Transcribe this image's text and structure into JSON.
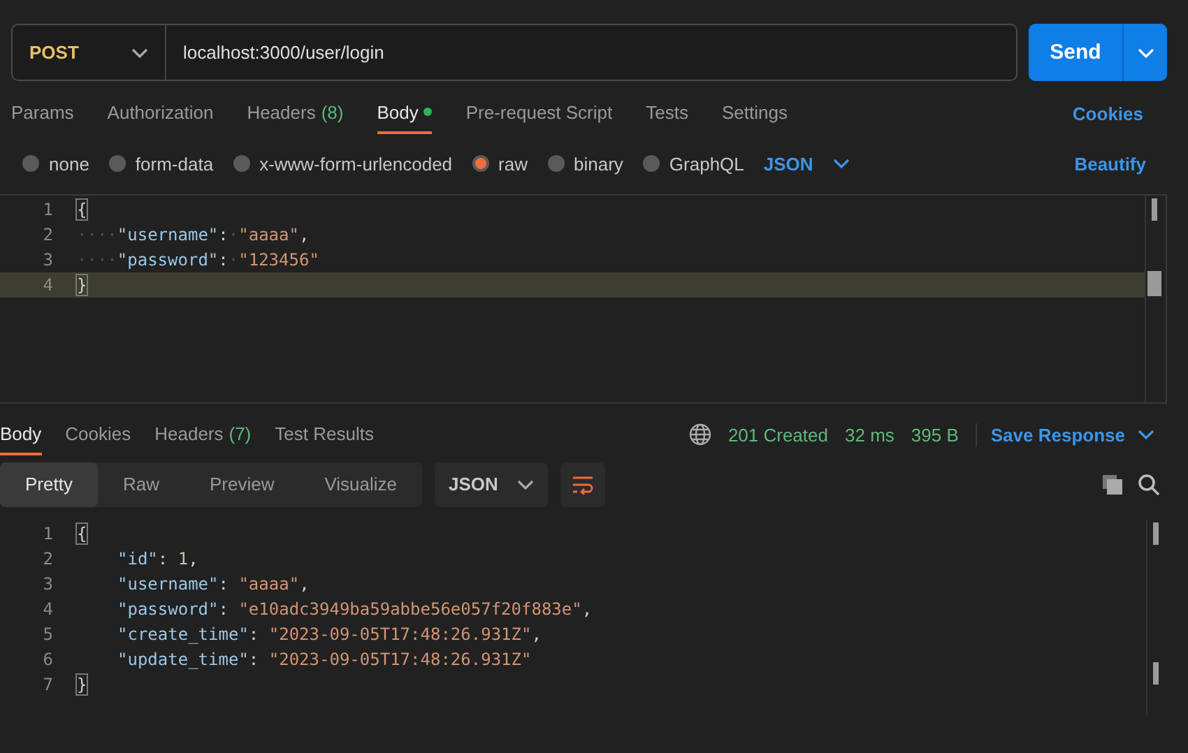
{
  "request": {
    "method": "POST",
    "url": "localhost:3000/user/login",
    "send_label": "Send"
  },
  "request_tabs": [
    {
      "label": "Params",
      "dot": false,
      "selected": false
    },
    {
      "label": "Authorization",
      "dot": false,
      "selected": false
    },
    {
      "label": "Headers",
      "count": "(8)",
      "dot": false,
      "selected": false
    },
    {
      "label": "Body",
      "dot": true,
      "selected": true
    },
    {
      "label": "Pre-request Script",
      "dot": false,
      "selected": false
    },
    {
      "label": "Tests",
      "dot": false,
      "selected": false
    },
    {
      "label": "Settings",
      "dot": false,
      "selected": false
    }
  ],
  "cookies_link": "Cookies",
  "body_types": [
    {
      "label": "none",
      "selected": false
    },
    {
      "label": "form-data",
      "selected": false
    },
    {
      "label": "x-www-form-urlencoded",
      "selected": false
    },
    {
      "label": "raw",
      "selected": true
    },
    {
      "label": "binary",
      "selected": false
    },
    {
      "label": "GraphQL",
      "selected": false
    }
  ],
  "raw_format": "JSON",
  "beautify_link": "Beautify",
  "request_editor": [
    {
      "number": "1",
      "current": false,
      "tokens": [
        {
          "kind": "brace",
          "text": "{"
        }
      ]
    },
    {
      "number": "2",
      "current": false,
      "tokens": [
        {
          "kind": "ws",
          "text": "····"
        },
        {
          "kind": "key",
          "text": "\"username\""
        },
        {
          "kind": "punct",
          "text": ":"
        },
        {
          "kind": "ws",
          "text": "·"
        },
        {
          "kind": "string",
          "text": "\"aaaa\""
        },
        {
          "kind": "punct",
          "text": ","
        }
      ]
    },
    {
      "number": "3",
      "current": false,
      "tokens": [
        {
          "kind": "ws",
          "text": "····"
        },
        {
          "kind": "key",
          "text": "\"password\""
        },
        {
          "kind": "punct",
          "text": ":"
        },
        {
          "kind": "ws",
          "text": "·"
        },
        {
          "kind": "string",
          "text": "\"123456\""
        }
      ]
    },
    {
      "number": "4",
      "current": true,
      "tokens": [
        {
          "kind": "brace",
          "text": "}"
        }
      ]
    }
  ],
  "response_tabs": [
    {
      "label": "Body",
      "selected": true
    },
    {
      "label": "Cookies",
      "selected": false
    },
    {
      "label": "Headers",
      "count": "(7)",
      "selected": false
    },
    {
      "label": "Test Results",
      "selected": false
    }
  ],
  "response_status": {
    "status": "201 Created",
    "time": "32 ms",
    "size": "395 B",
    "save_label": "Save Response"
  },
  "view_modes": [
    {
      "label": "Pretty",
      "selected": true
    },
    {
      "label": "Raw",
      "selected": false
    },
    {
      "label": "Preview",
      "selected": false
    },
    {
      "label": "Visualize",
      "selected": false
    }
  ],
  "response_format": "JSON",
  "response_editor": [
    {
      "number": "1",
      "indented": false,
      "tokens": [
        {
          "kind": "brace",
          "text": "{"
        }
      ]
    },
    {
      "number": "2",
      "indented": true,
      "tokens": [
        {
          "kind": "key",
          "text": "\"id\""
        },
        {
          "kind": "punct",
          "text": ": "
        },
        {
          "kind": "number",
          "text": "1"
        },
        {
          "kind": "punct",
          "text": ","
        }
      ]
    },
    {
      "number": "3",
      "indented": true,
      "tokens": [
        {
          "kind": "key",
          "text": "\"username\""
        },
        {
          "kind": "punct",
          "text": ": "
        },
        {
          "kind": "string",
          "text": "\"aaaa\""
        },
        {
          "kind": "punct",
          "text": ","
        }
      ]
    },
    {
      "number": "4",
      "indented": true,
      "tokens": [
        {
          "kind": "key",
          "text": "\"password\""
        },
        {
          "kind": "punct",
          "text": ": "
        },
        {
          "kind": "string",
          "text": "\"e10adc3949ba59abbe56e057f20f883e\""
        },
        {
          "kind": "punct",
          "text": ","
        }
      ]
    },
    {
      "number": "5",
      "indented": true,
      "tokens": [
        {
          "kind": "key",
          "text": "\"create_time\""
        },
        {
          "kind": "punct",
          "text": ": "
        },
        {
          "kind": "string",
          "text": "\"2023-09-05T17:48:26.931Z\""
        },
        {
          "kind": "punct",
          "text": ","
        }
      ]
    },
    {
      "number": "6",
      "indented": true,
      "tokens": [
        {
          "kind": "key",
          "text": "\"update_time\""
        },
        {
          "kind": "punct",
          "text": ": "
        },
        {
          "kind": "string",
          "text": "\"2023-09-05T17:48:26.931Z\""
        }
      ]
    },
    {
      "number": "7",
      "indented": false,
      "tokens": [
        {
          "kind": "brace",
          "text": "}"
        }
      ]
    }
  ]
}
